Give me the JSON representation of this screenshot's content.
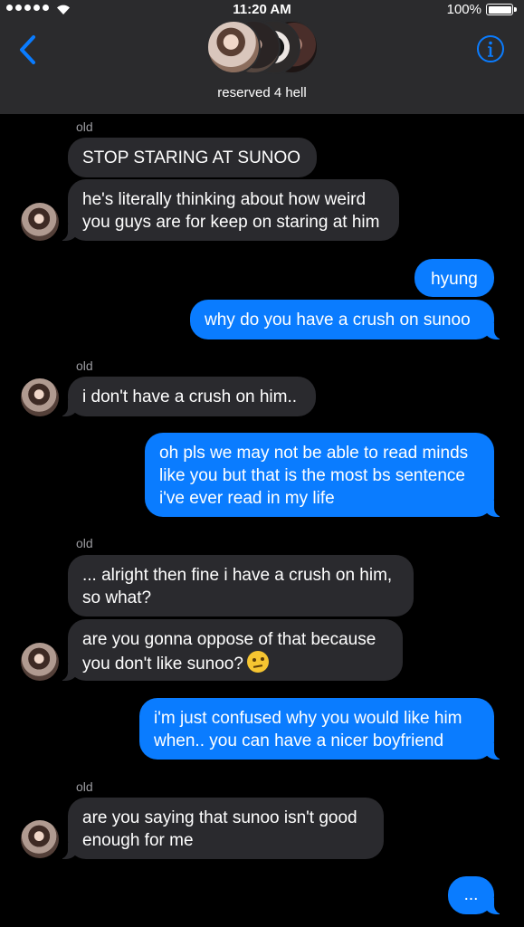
{
  "status_bar": {
    "time": "11:20 AM",
    "battery_percent": "100%",
    "signal_bars": 5
  },
  "header": {
    "group_name": "reserved 4 hell",
    "icons": [
      "back-chevron-icon",
      "info-icon"
    ],
    "accent_color": "#0a7cff"
  },
  "messages": [
    {
      "type": "sender",
      "text": "old"
    },
    {
      "type": "in",
      "text": "STOP STARING AT SUNOO"
    },
    {
      "type": "in",
      "text": "he's literally thinking about how weird you guys are for keep on staring at him"
    },
    {
      "type": "out",
      "text": "hyung"
    },
    {
      "type": "out",
      "text": "why do you have a crush on sunoo"
    },
    {
      "type": "sender",
      "text": "old"
    },
    {
      "type": "in",
      "text": "i don't have a crush on him.."
    },
    {
      "type": "out",
      "text": "oh pls we may not be able to read minds like you but that is the most bs sentence i've ever read in my life"
    },
    {
      "type": "sender",
      "text": "old"
    },
    {
      "type": "in",
      "text": "... alright then fine i have a crush on him, so what?"
    },
    {
      "type": "in",
      "text": "are you gonna oppose of that because you don't like sunoo?",
      "emoji": "face-with-raised-eyebrow"
    },
    {
      "type": "out",
      "text": "i'm just confused why you would like him when.. you can have a nicer boyfriend"
    },
    {
      "type": "sender",
      "text": "old"
    },
    {
      "type": "in",
      "text": "are you saying that sunoo isn't good enough for me"
    },
    {
      "type": "out",
      "text": "..."
    }
  ]
}
